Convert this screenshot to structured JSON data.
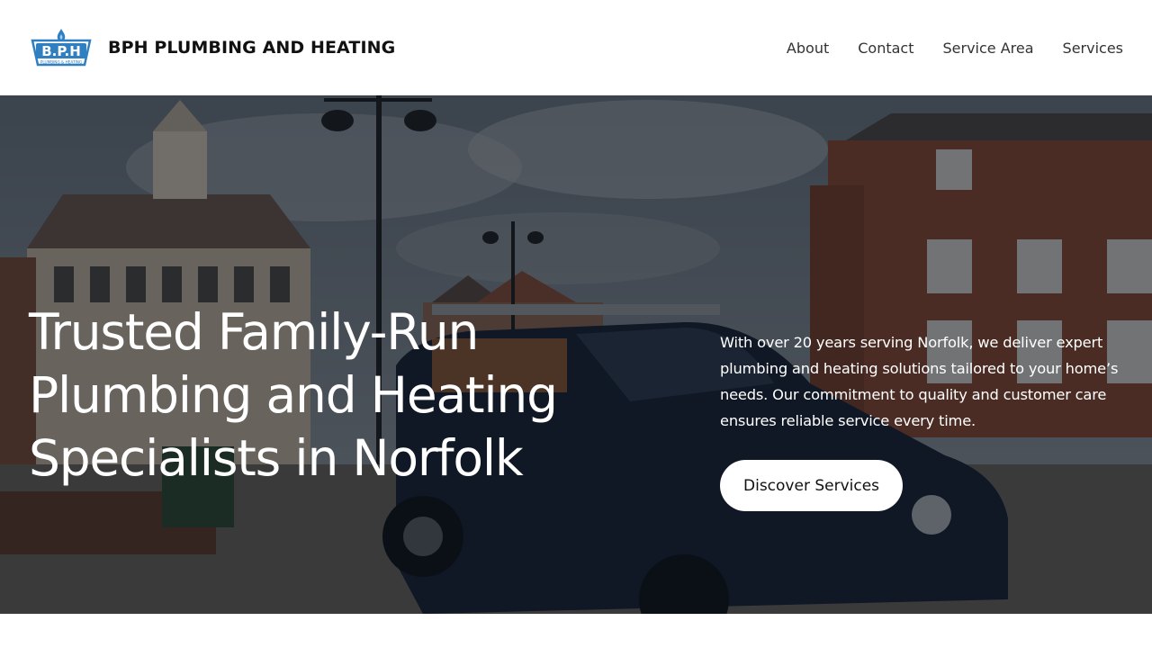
{
  "header": {
    "logo_text": "B.P.H",
    "logo_subtext": "PLUMBING & HEATING",
    "site_title": "BPH PLUMBING AND HEATING",
    "nav": [
      {
        "label": "About"
      },
      {
        "label": "Contact"
      },
      {
        "label": "Service Area"
      },
      {
        "label": "Services"
      }
    ]
  },
  "hero": {
    "title_lines": [
      "Trusted Family-Run",
      "Plumbing and Heating",
      "Specialists in Norfolk"
    ],
    "description": "With over 20 years serving Norfolk, we deliver expert plumbing and heating solutions tailored to your home’s needs. Our commitment to quality and customer care ensures reliable service every time.",
    "cta_label": "Discover Services"
  },
  "colors": {
    "header_bg": "#ffffff",
    "hero_overlay": "#0a0e14",
    "logo_blue": "#2f7fc1",
    "cta_bg": "#ffffff"
  },
  "icons": {
    "logo": "bph-flame-logo"
  }
}
